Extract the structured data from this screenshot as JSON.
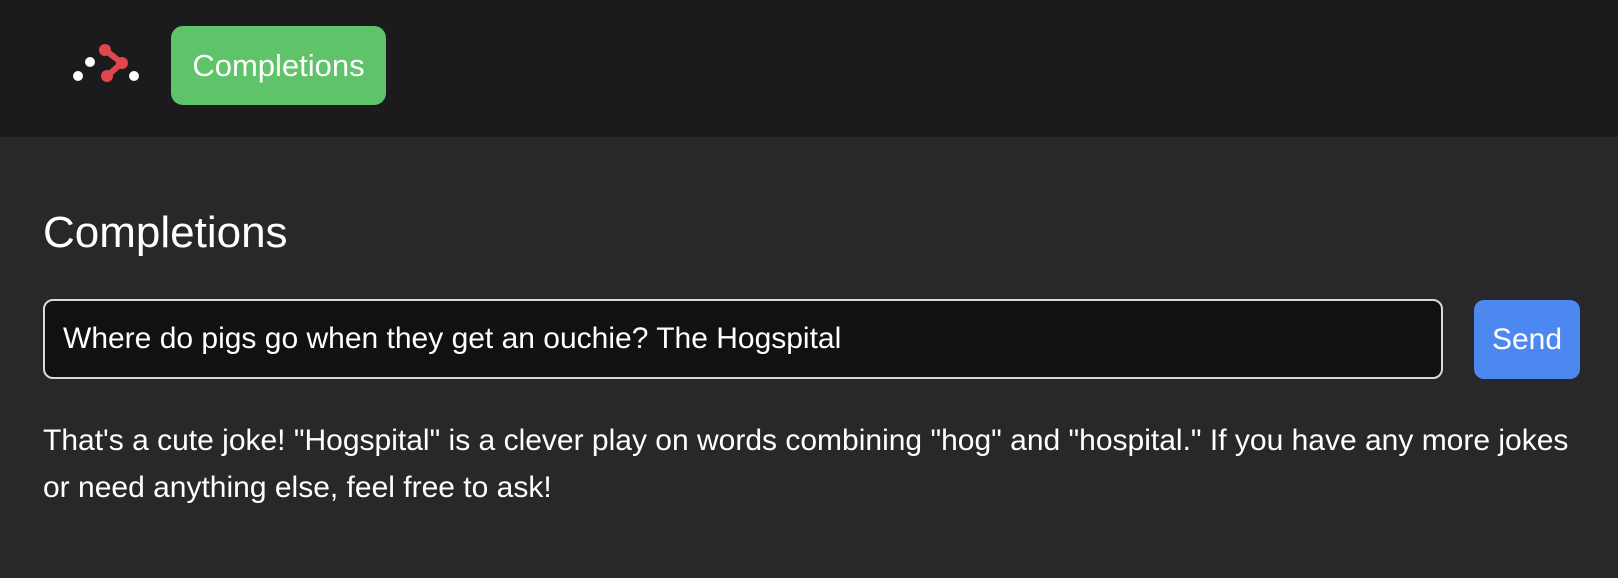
{
  "header": {
    "logo_icon": "network-nodes-logo",
    "nav_button_label": "Completions",
    "nav_button_color": "#5fc36a"
  },
  "main": {
    "title": "Completions",
    "prompt": {
      "value": "Where do pigs go when they get an ouchie? The Hogspital"
    },
    "send_label": "Send",
    "send_color": "#4d87f0",
    "response": "That's a cute joke! \"Hogspital\" is a clever play on words combining \"hog\" and \"hospital.\" If you have any more jokes or need anything else, feel free to ask!"
  },
  "colors": {
    "header_bg": "#1b1b1d",
    "page_bg": "#28282b",
    "logo_accent": "#e0474c"
  }
}
